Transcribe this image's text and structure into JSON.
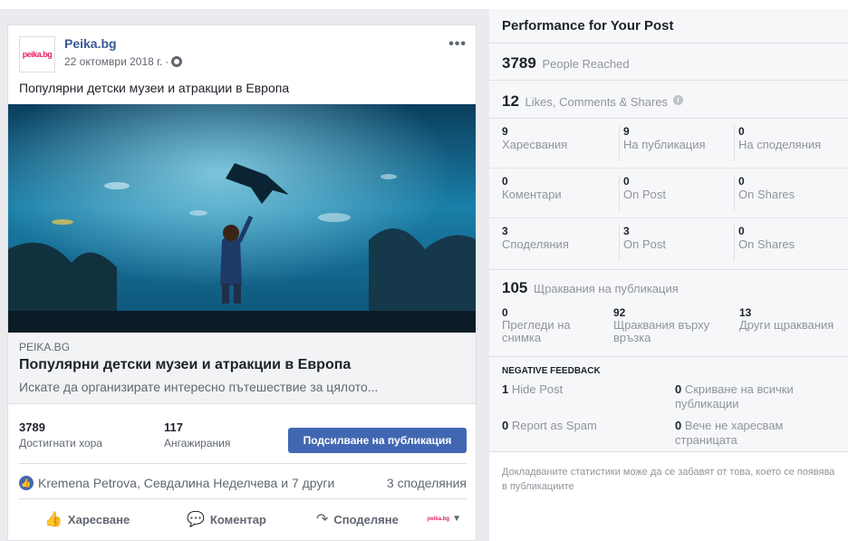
{
  "post": {
    "page_logo_text": "peika.bg",
    "page_name": "Peika.bg",
    "date": "22 октомври 2018 г.",
    "more_icon": "ellipsis-icon",
    "text": "Популярни детски музеи и атракции в Европа",
    "link": {
      "domain": "PEIKA.BG",
      "title": "Популярни детски музеи и атракции в Европа",
      "description": "Искате да организирате интересно пътешествие за цялото..."
    },
    "stats": {
      "reached_value": "3789",
      "reached_label": "Достигнати хора",
      "engagements_value": "117",
      "engagements_label": "Ангажирания"
    },
    "boost_label": "Подсилване на публикация",
    "reactions": {
      "names": "Kremena Petrova, Севдалина Неделчева и 7 други",
      "shares": "3 споделяния"
    },
    "actions": {
      "like": "Харесване",
      "comment": "Коментар",
      "share": "Споделяне"
    },
    "colors": {
      "brand_blue": "#4267b2",
      "link_blue": "#385898"
    }
  },
  "performance": {
    "title": "Performance for Your Post",
    "reached": {
      "value": "3789",
      "label": "People Reached"
    },
    "engagement": {
      "value": "12",
      "label": "Likes, Comments & Shares"
    },
    "breakdown": [
      [
        {
          "value": "9",
          "label": "Харесвания"
        },
        {
          "value": "9",
          "label": "На публикация"
        },
        {
          "value": "0",
          "label": "На споделяния"
        }
      ],
      [
        {
          "value": "0",
          "label": "Коментари"
        },
        {
          "value": "0",
          "label": "On Post"
        },
        {
          "value": "0",
          "label": "On Shares"
        }
      ],
      [
        {
          "value": "3",
          "label": "Споделяния"
        },
        {
          "value": "3",
          "label": "On Post"
        },
        {
          "value": "0",
          "label": "On Shares"
        }
      ]
    ],
    "clicks": {
      "value": "105",
      "label": "Щраквания на публикация",
      "items": [
        {
          "value": "0",
          "label": "Прегледи на снимка"
        },
        {
          "value": "92",
          "label": "Щраквания върху връзка"
        },
        {
          "value": "13",
          "label": "Други щраквания"
        }
      ]
    },
    "negative": {
      "heading": "NEGATIVE FEEDBACK",
      "items": [
        {
          "value": "1",
          "label": "Hide Post"
        },
        {
          "value": "0",
          "label": "Скриване на всички публикации"
        },
        {
          "value": "0",
          "label": "Report as Spam"
        },
        {
          "value": "0",
          "label": "Вече не харесвам страницата"
        }
      ]
    },
    "footer": "Докладваните статистики може да се забавят от това, което се появява в публикациите"
  }
}
